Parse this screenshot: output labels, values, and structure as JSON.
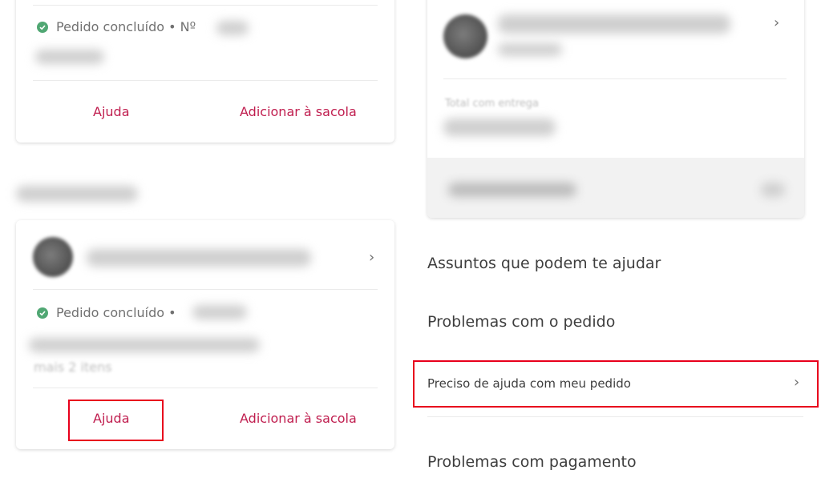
{
  "left": {
    "card1": {
      "status": "Pedido concluído • Nº",
      "help_label": "Ajuda",
      "add_label": "Adicionar à sacola"
    },
    "card2": {
      "status": "Pedido concluído •",
      "items_more": "mais 2 itens",
      "help_label": "Ajuda",
      "add_label": "Adicionar à sacola"
    }
  },
  "right": {
    "order_card": {
      "total_label": "Total com entrega"
    },
    "section_title": "Assuntos que podem te ajudar",
    "topics": {
      "orders": "Problemas com o pedido",
      "help_order": "Preciso de ajuda com meu pedido",
      "payment": "Problemas com pagamento"
    }
  },
  "colors": {
    "accent": "#c01e4f",
    "success": "#50a773",
    "highlight": "#e8001c"
  },
  "icons": [
    "check-circle-icon",
    "chevron-right-icon"
  ]
}
